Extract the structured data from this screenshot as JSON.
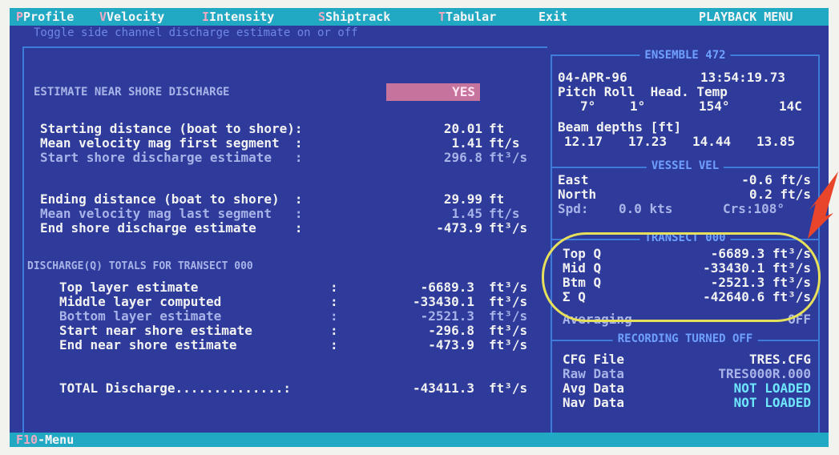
{
  "menu": {
    "items": [
      "Profile",
      "Velocity",
      "Intensity",
      "Shiptrack",
      "Tabular",
      "Exit"
    ],
    "hotkeys": [
      "P",
      "V",
      "I",
      "S",
      "T",
      "x"
    ],
    "title": "PLAYBACK MENU"
  },
  "hint": "Toggle side channel discharge estimate on or off",
  "left": {
    "estimate_label": "ESTIMATE NEAR SHORE DISCHARGE",
    "estimate_value": "YES",
    "rows": [
      {
        "label": "Starting distance (boat to shore):",
        "value": "20.01",
        "unit": "ft"
      },
      {
        "label": "Mean velocity mag first segment  :",
        "value": "1.41",
        "unit": "ft/s"
      },
      {
        "label": "Start shore discharge estimate   :",
        "value": "296.8",
        "unit": "ft³/s"
      },
      {
        "label": "Ending distance (boat to shore)  :",
        "value": "29.99",
        "unit": "ft"
      },
      {
        "label": "Mean velocity mag last segment   :",
        "value": "1.45",
        "unit": "ft/s"
      },
      {
        "label": "End shore discharge estimate     :",
        "value": "-473.9",
        "unit": "ft³/s"
      }
    ],
    "totals_title": "DISCHARGE(Q) TOTALS FOR TRANSECT 000",
    "totals": [
      {
        "label": "Top layer estimate",
        "value": "-6689.3",
        "unit": "ft³/s"
      },
      {
        "label": "Middle layer computed",
        "value": "-33430.1",
        "unit": "ft³/s"
      },
      {
        "label": "Bottom layer estimate",
        "value": "-2521.3",
        "unit": "ft³/s"
      },
      {
        "label": "Start near shore estimate",
        "value": "-296.8",
        "unit": "ft³/s"
      },
      {
        "label": "End near shore estimate",
        "value": "-473.9",
        "unit": "ft³/s"
      }
    ],
    "total_label": "TOTAL Discharge..............:",
    "total_value": "-43411.3",
    "total_unit": "ft³/s"
  },
  "right": {
    "ensemble_title": "ENSEMBLE 472",
    "date": "04-APR-96",
    "time": "13:54:19.73",
    "pitch_roll_header": "Pitch Roll  Head. Temp",
    "pitch": "7°",
    "roll": "1°",
    "head": "154°",
    "temp": "14C",
    "beam_header": "Beam depths [ft]",
    "beams": [
      "12.17",
      "17.23",
      "14.44",
      "13.85"
    ],
    "vel_title": "VESSEL VEL",
    "east_label": "East",
    "east_value": "-0.6 ft/s",
    "north_label": "North",
    "north_value": "0.2 ft/s",
    "spd_label": "Spd:",
    "spd_value": "0.0 kts",
    "crs_value": "Crs:108°",
    "transect_title": "TRANSECT 000",
    "q_rows": [
      {
        "label": "Top Q",
        "value": "-6689.3 ft³/s"
      },
      {
        "label": "Mid Q",
        "value": "-33430.1 ft³/s"
      },
      {
        "label": "Btm Q",
        "value": "-2521.3 ft³/s"
      },
      {
        "label": "Σ Q",
        "value": "-42640.6 ft³/s"
      }
    ],
    "averaging_label": "Averaging",
    "averaging_value": "OFF",
    "recording_title": "RECORDING TURNED OFF",
    "files": [
      {
        "label": "CFG File",
        "value": "TRES.CFG"
      },
      {
        "label": "Raw Data",
        "value": "TRES000R.000"
      },
      {
        "label": "Avg Data",
        "value": "NOT LOADED"
      },
      {
        "label": "Nav Data",
        "value": "NOT LOADED"
      }
    ]
  },
  "status": {
    "key": "F10",
    "label": "-Menu"
  }
}
